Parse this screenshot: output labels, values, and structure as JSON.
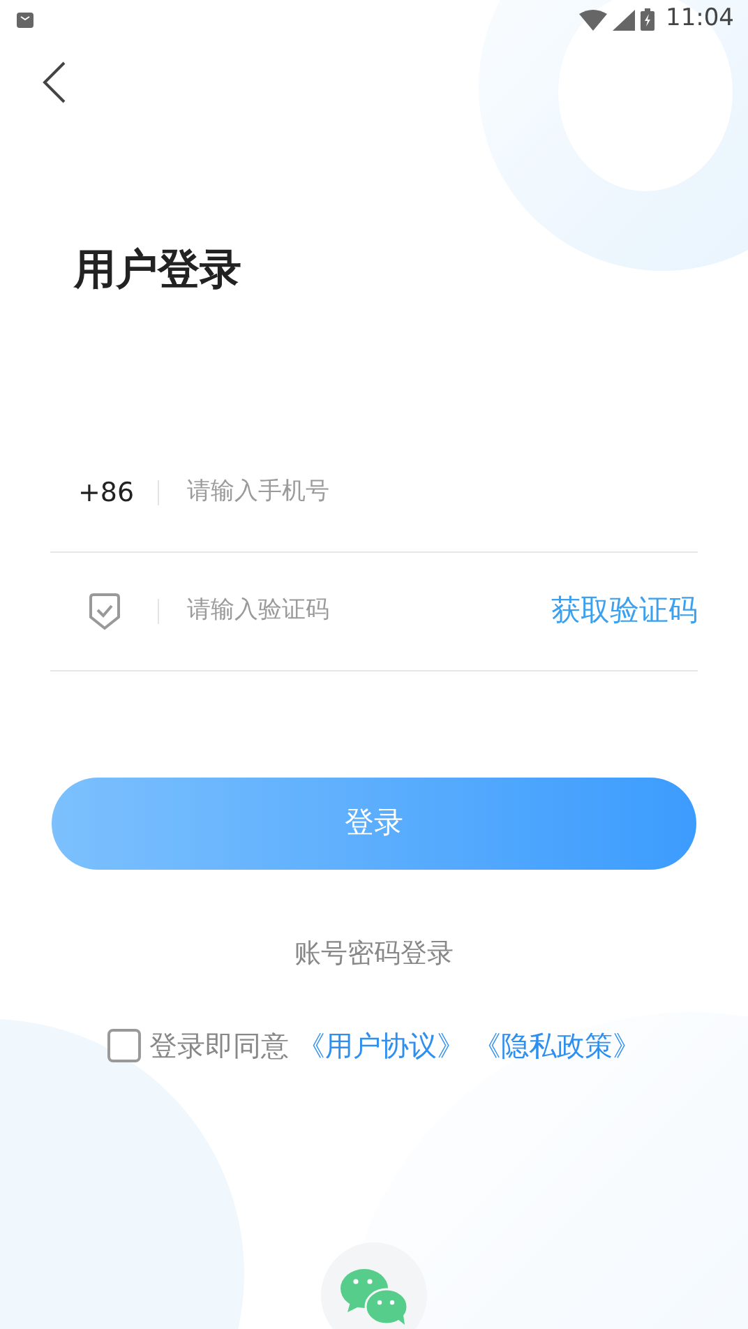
{
  "status_bar": {
    "time": "11:04"
  },
  "title": "用户登录",
  "phone_field": {
    "prefix": "+86",
    "placeholder": "请输入手机号"
  },
  "code_field": {
    "placeholder": "请输入验证码",
    "action": "获取验证码"
  },
  "login_button": "登录",
  "alt_login": "账号密码登录",
  "agreement": {
    "checked": false,
    "text": "登录即同意",
    "links": [
      "《用户协议》",
      "《隐私政策》"
    ]
  }
}
